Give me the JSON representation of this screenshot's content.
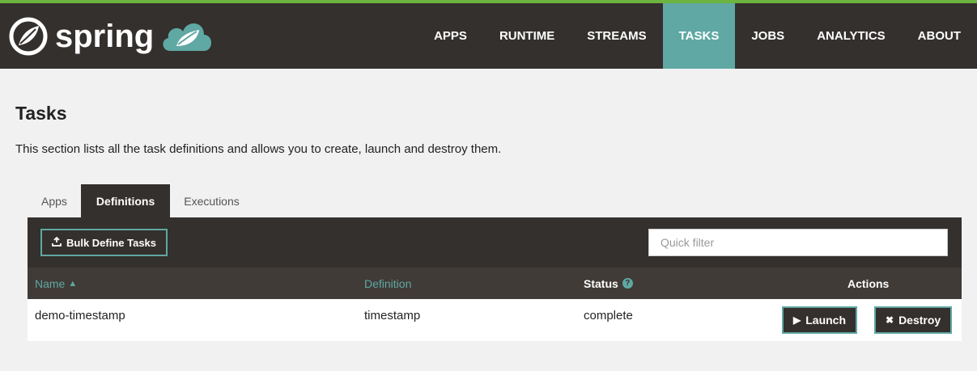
{
  "brand": {
    "name": "spring",
    "logo_icon": "spring-leaf-icon",
    "cloud_icon": "cloud-data-icon",
    "accent": "#6db33f",
    "teal": "#5fa8a3"
  },
  "nav": {
    "items": [
      {
        "label": "APPS"
      },
      {
        "label": "RUNTIME"
      },
      {
        "label": "STREAMS"
      },
      {
        "label": "TASKS",
        "active": true
      },
      {
        "label": "JOBS"
      },
      {
        "label": "ANALYTICS"
      },
      {
        "label": "ABOUT"
      }
    ]
  },
  "page": {
    "title": "Tasks",
    "description": "This section lists all the task definitions and allows you to create, launch and destroy them."
  },
  "tabs": [
    {
      "label": "Apps"
    },
    {
      "label": "Definitions",
      "active": true
    },
    {
      "label": "Executions"
    }
  ],
  "toolbar": {
    "bulk_label": "Bulk Define Tasks",
    "bulk_icon": "upload-tray-icon",
    "filter_placeholder": "Quick filter"
  },
  "table": {
    "headers": {
      "name": "Name",
      "definition": "Definition",
      "status": "Status",
      "actions": "Actions"
    },
    "sort_icon": "sort-asc-icon",
    "help_icon": "question-circle-icon",
    "rows": [
      {
        "name": "demo-timestamp",
        "definition": "timestamp",
        "status": "complete",
        "launch_label": "Launch",
        "destroy_label": "Destroy"
      }
    ]
  }
}
